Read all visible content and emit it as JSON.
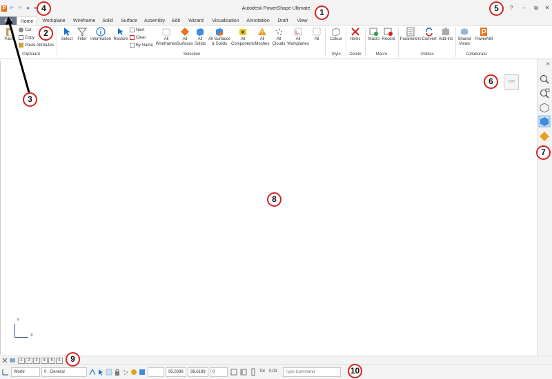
{
  "window": {
    "title": "Autodesk PowerShape Ultimate",
    "logo_letter": "P",
    "quick_access": {
      "undo": "↶",
      "redo": "↷",
      "select": "➤",
      "more": "≡"
    },
    "controls": {
      "help": "?",
      "minimize": "–",
      "restore": "⧉",
      "close": "✕"
    },
    "doc_controls": {
      "minimize": "–",
      "restore": "⧉",
      "close": "✕"
    }
  },
  "tabs": [
    {
      "label": "File"
    },
    {
      "label": "Home"
    },
    {
      "label": "Workplane"
    },
    {
      "label": "Wireframe"
    },
    {
      "label": "Solid"
    },
    {
      "label": "Surface"
    },
    {
      "label": "Assembly"
    },
    {
      "label": "Edit"
    },
    {
      "label": "Wizard"
    },
    {
      "label": "Visualisation"
    },
    {
      "label": "Annotation"
    },
    {
      "label": "Draft"
    },
    {
      "label": "View"
    }
  ],
  "ribbon": {
    "clipboard": {
      "group_label": "Clipboard",
      "paste": "Paste",
      "cut": "Cut",
      "copy": "Copy",
      "paste_attributes": "Paste Attributes"
    },
    "selection": {
      "group_label": "Selection",
      "select": "Select",
      "filter": "Filter",
      "information": "Information",
      "restore": "Restore",
      "next": "Next",
      "clear": "Clear",
      "by_name": "By Name",
      "items": [
        {
          "line1": "All",
          "line2": "Wireframes"
        },
        {
          "line1": "All",
          "line2": "Surfaces"
        },
        {
          "line1": "All",
          "line2": "Solids"
        },
        {
          "line1": "All Surfaces",
          "line2": "& Solids"
        },
        {
          "line1": "All",
          "line2": "Components"
        },
        {
          "line1": "All",
          "line2": "Meshes"
        },
        {
          "line1": "All",
          "line2": "Clouds"
        },
        {
          "line1": "All",
          "line2": "Workplanes"
        },
        {
          "line1": "All",
          "line2": ""
        }
      ]
    },
    "style": {
      "group_label": "Style",
      "colour": "Colour"
    },
    "delete": {
      "group_label": "Delete",
      "items": "Items"
    },
    "macro": {
      "group_label": "Macro",
      "macro": "Macro",
      "record": "Record"
    },
    "utilities": {
      "group_label": "Utilities",
      "parameters": "Parameters",
      "convert": "Convert",
      "addins": "Add-Ins"
    },
    "collaborate": {
      "group_label": "Collaborate",
      "shared_views": "Shared",
      "shared_views2": "Views",
      "powermill": "PowerMill"
    }
  },
  "viewport": {
    "view_cube_label": "TOP",
    "axis_y": "Y",
    "axis_x": "X"
  },
  "view_toolbar": {
    "close": "✕"
  },
  "tabstrip": {
    "pages": [
      "1",
      "2",
      "3",
      "4",
      "5",
      "6"
    ]
  },
  "status": {
    "workplane": "World",
    "level": "0 : General",
    "coord_x": "95.0398",
    "coord_y": "98.6188",
    "coord_z": "0",
    "tol_label": "Tol",
    "tol_value": "0.01",
    "command_placeholder": "Type Command"
  },
  "callouts": [
    "1",
    "2",
    "3",
    "4",
    "5",
    "6",
    "7",
    "8",
    "9",
    "10"
  ],
  "colors": {
    "accent": "#e8711a",
    "file_tab": "#6b7686",
    "callout": "#d62020",
    "select_blue": "#1a6fc6"
  }
}
